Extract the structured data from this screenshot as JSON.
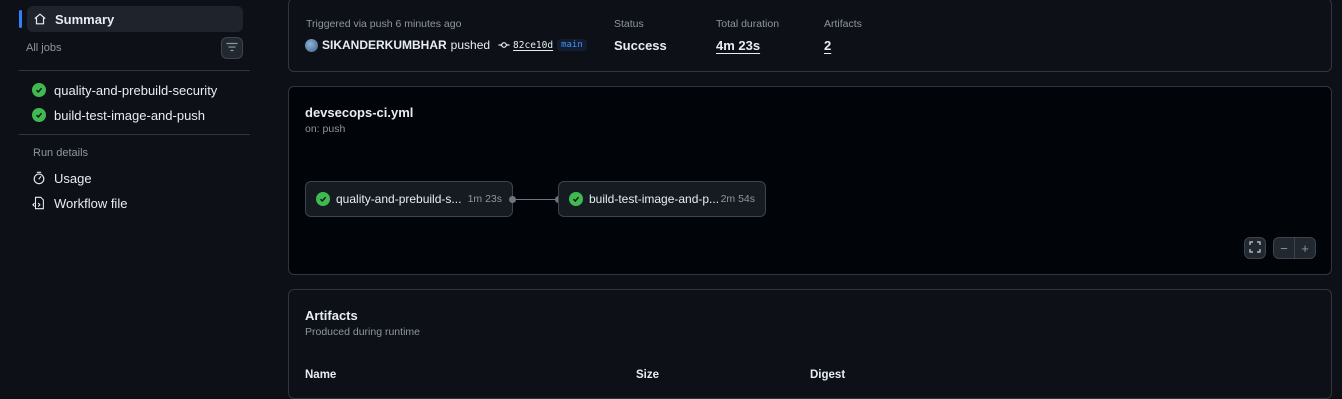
{
  "sidebar": {
    "summary_label": "Summary",
    "all_jobs_label": "All jobs",
    "jobs": [
      {
        "label": "quality-and-prebuild-security",
        "status": "success"
      },
      {
        "label": "build-test-image-and-push",
        "status": "success"
      }
    ],
    "run_details_label": "Run details",
    "usage_label": "Usage",
    "workflow_file_label": "Workflow file"
  },
  "summary": {
    "trigger_text": "Triggered via push 6 minutes ago",
    "actor": "SIKANDERKUMBHAR",
    "action": "pushed",
    "commit": "82ce10d",
    "branch": "main",
    "status_label": "Status",
    "status_value": "Success",
    "duration_label": "Total duration",
    "duration_value": "4m 23s",
    "artifacts_label": "Artifacts",
    "artifacts_value": "2"
  },
  "workflow": {
    "title": "devsecops-ci.yml",
    "subtitle": "on: push",
    "jobs": [
      {
        "name": "quality-and-prebuild-s...",
        "duration": "1m 23s"
      },
      {
        "name": "build-test-image-and-p...",
        "duration": "2m 54s"
      }
    ],
    "zoom_out": "−",
    "zoom_in": "+"
  },
  "artifacts": {
    "title": "Artifacts",
    "subtitle": "Produced during runtime",
    "columns": [
      "Name",
      "Size",
      "Digest"
    ]
  },
  "colors": {
    "accent": "#2f81f7",
    "success": "#3fb950",
    "background": "#0d1117"
  }
}
